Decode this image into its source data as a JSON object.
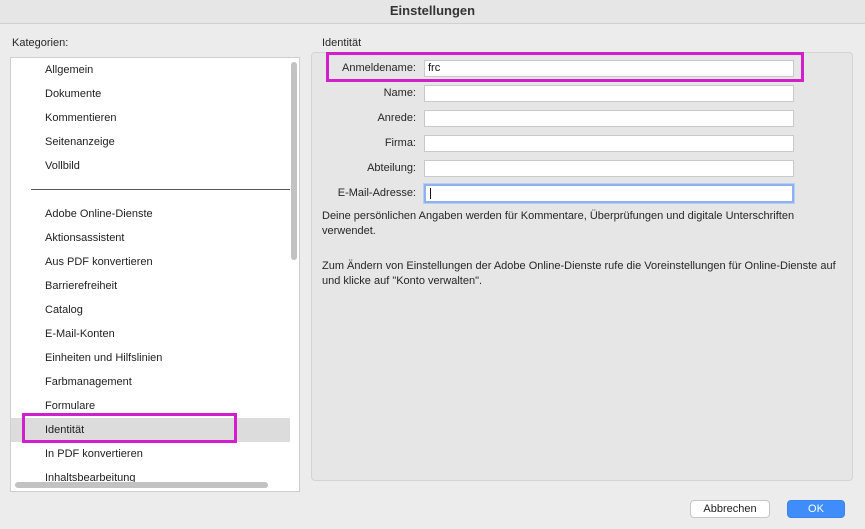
{
  "window": {
    "title": "Einstellungen"
  },
  "categories": {
    "label": "Kategorien:",
    "top_items": [
      "Allgemein",
      "Dokumente",
      "Kommentieren",
      "Seitenanzeige",
      "Vollbild"
    ],
    "items": [
      "Adobe Online-Dienste",
      "Aktionsassistent",
      "Aus PDF konvertieren",
      "Barrierefreiheit",
      "Catalog",
      "E-Mail-Konten",
      "Einheiten und Hilfslinien",
      "Farbmanagement",
      "Formulare",
      "Identität",
      "In PDF konvertieren",
      "Inhaltsbearbeitung"
    ],
    "selected": "Identität"
  },
  "identity": {
    "section_title": "Identität",
    "fields": {
      "login_name": {
        "label": "Anmeldename:",
        "value": "frc"
      },
      "name": {
        "label": "Name:",
        "value": ""
      },
      "salutation": {
        "label": "Anrede:",
        "value": ""
      },
      "company": {
        "label": "Firma:",
        "value": ""
      },
      "department": {
        "label": "Abteilung:",
        "value": ""
      },
      "email": {
        "label": "E-Mail-Adresse:",
        "value": ""
      }
    },
    "info_1": "Deine persönlichen Angaben werden für Kommentare, Überprüfungen und digitale Unterschriften verwendet.",
    "info_2": "Zum Ändern von Einstellungen der Adobe Online-Dienste rufe die Voreinstellungen für Online-Dienste auf und klicke auf \"Konto verwalten\"."
  },
  "buttons": {
    "cancel": "Abbrechen",
    "ok": "OK"
  },
  "colors": {
    "highlight": "#d21fcc",
    "accent": "#3f8dfb",
    "focus_ring": "#8fb2ee"
  }
}
